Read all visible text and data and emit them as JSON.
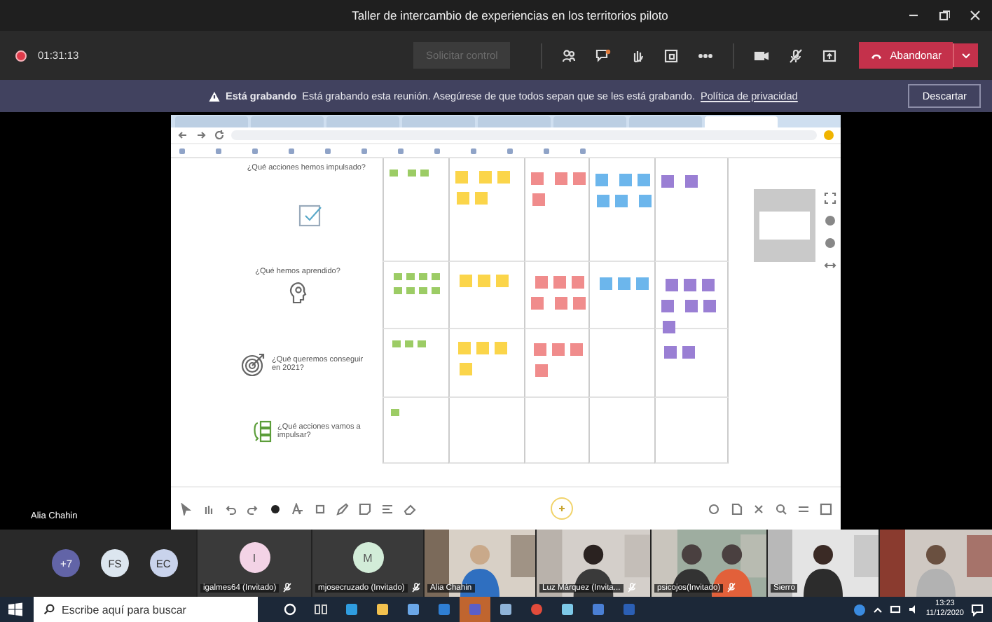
{
  "window": {
    "title": "Taller de intercambio de experiencias en los territorios piloto"
  },
  "meeting_bar": {
    "recording": true,
    "timer": "01:31:13",
    "request_control": {
      "label": "Solicitar control",
      "disabled": true
    },
    "leave_button": "Abandonar"
  },
  "recording_banner": {
    "title": "Está grabando",
    "message": "Está grabando esta reunión. Asegúrese de que todos sepan que se les está grabando.",
    "link": "Política de privacidad",
    "dismiss": "Descartar"
  },
  "shared_screen": {
    "presenter": "Alia Chahin",
    "browser_tabs": [
      {
        "selected": false
      },
      {
        "selected": false
      },
      {
        "selected": false
      },
      {
        "selected": false
      },
      {
        "selected": false
      },
      {
        "selected": false
      },
      {
        "selected": false
      },
      {
        "selected": true
      }
    ],
    "board": {
      "columns": [
        {
          "color": "#9ccc65"
        },
        {
          "color": "#fbd54a"
        },
        {
          "color": "#f08c8c"
        },
        {
          "color": "#6cb6ec"
        },
        {
          "color": "#9a7fd4"
        }
      ],
      "rows": [
        {
          "question": "¿Qué acciones hemos impulsado?"
        },
        {
          "question": "¿Qué hemos aprendido?"
        },
        {
          "question": "¿Qué queremos conseguir en 2021?"
        },
        {
          "question": "¿Qué acciones vamos a impulsar?"
        }
      ]
    }
  },
  "participants": {
    "overflow": "+7",
    "avatars": [
      {
        "initials": "FS",
        "color": "#dce6ef"
      },
      {
        "initials": "EC",
        "color": "#c9d3ec"
      }
    ],
    "tiles": [
      {
        "kind": "avatar",
        "initial": "I",
        "color": "#f3d3e6",
        "name": "igalmes64 (Invitado)",
        "muted": true
      },
      {
        "kind": "avatar",
        "initial": "M",
        "color": "#d2ecd8",
        "name": "mjosecruzado (Invitado)",
        "muted": true
      },
      {
        "kind": "video",
        "name": "Alia Chahin",
        "muted": false
      },
      {
        "kind": "video",
        "name": "Luz Márquez (Invita...",
        "muted": true
      },
      {
        "kind": "video",
        "name": "psicojos(Invitado)",
        "muted": true
      },
      {
        "kind": "video",
        "name": "Sierro",
        "muted": false
      },
      {
        "kind": "video"
      }
    ]
  },
  "taskbar": {
    "search": {
      "placeholder": "Escribe aquí para buscar"
    },
    "apps": [
      {
        "selected": false
      },
      {
        "selected": false
      },
      {
        "selected": false
      },
      {
        "selected": false
      },
      {
        "selected": false
      },
      {
        "selected": false
      },
      {
        "selected": true
      },
      {
        "selected": false
      },
      {
        "selected": false
      },
      {
        "selected": false
      },
      {
        "selected": false
      },
      {
        "selected": false
      }
    ],
    "time": "13:23",
    "date": "11/12/2020"
  }
}
